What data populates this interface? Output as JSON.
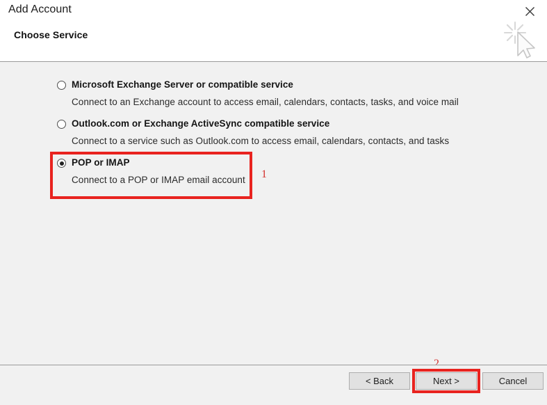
{
  "window": {
    "title": "Add Account",
    "subtitle": "Choose Service",
    "close_label": "✕"
  },
  "icons": {
    "close": "close-icon",
    "cursor": "busy-cursor-icon"
  },
  "colors": {
    "annotation_red": "#e8231f",
    "marker_red": "#d3302c",
    "header_bg": "#ffffff",
    "body_bg": "#f1f1f1",
    "button_bg": "#e1e1e1"
  },
  "options": [
    {
      "id": "exchange",
      "label": "Microsoft Exchange Server or compatible service",
      "description": "Connect to an Exchange account to access email, calendars, contacts, tasks, and voice mail",
      "selected": false
    },
    {
      "id": "outlook-activesync",
      "label": "Outlook.com or Exchange ActiveSync compatible service",
      "description": "Connect to a service such as Outlook.com to access email, calendars, contacts, and tasks",
      "selected": false
    },
    {
      "id": "pop-imap",
      "label": "POP or IMAP",
      "description": "Connect to a POP or IMAP email account",
      "selected": true
    }
  ],
  "annotations": [
    {
      "id": "step-1",
      "text": "1"
    },
    {
      "id": "step-2",
      "text": "2"
    }
  ],
  "footer": {
    "back_label": "< Back",
    "next_label": "Next >",
    "cancel_label": "Cancel"
  }
}
